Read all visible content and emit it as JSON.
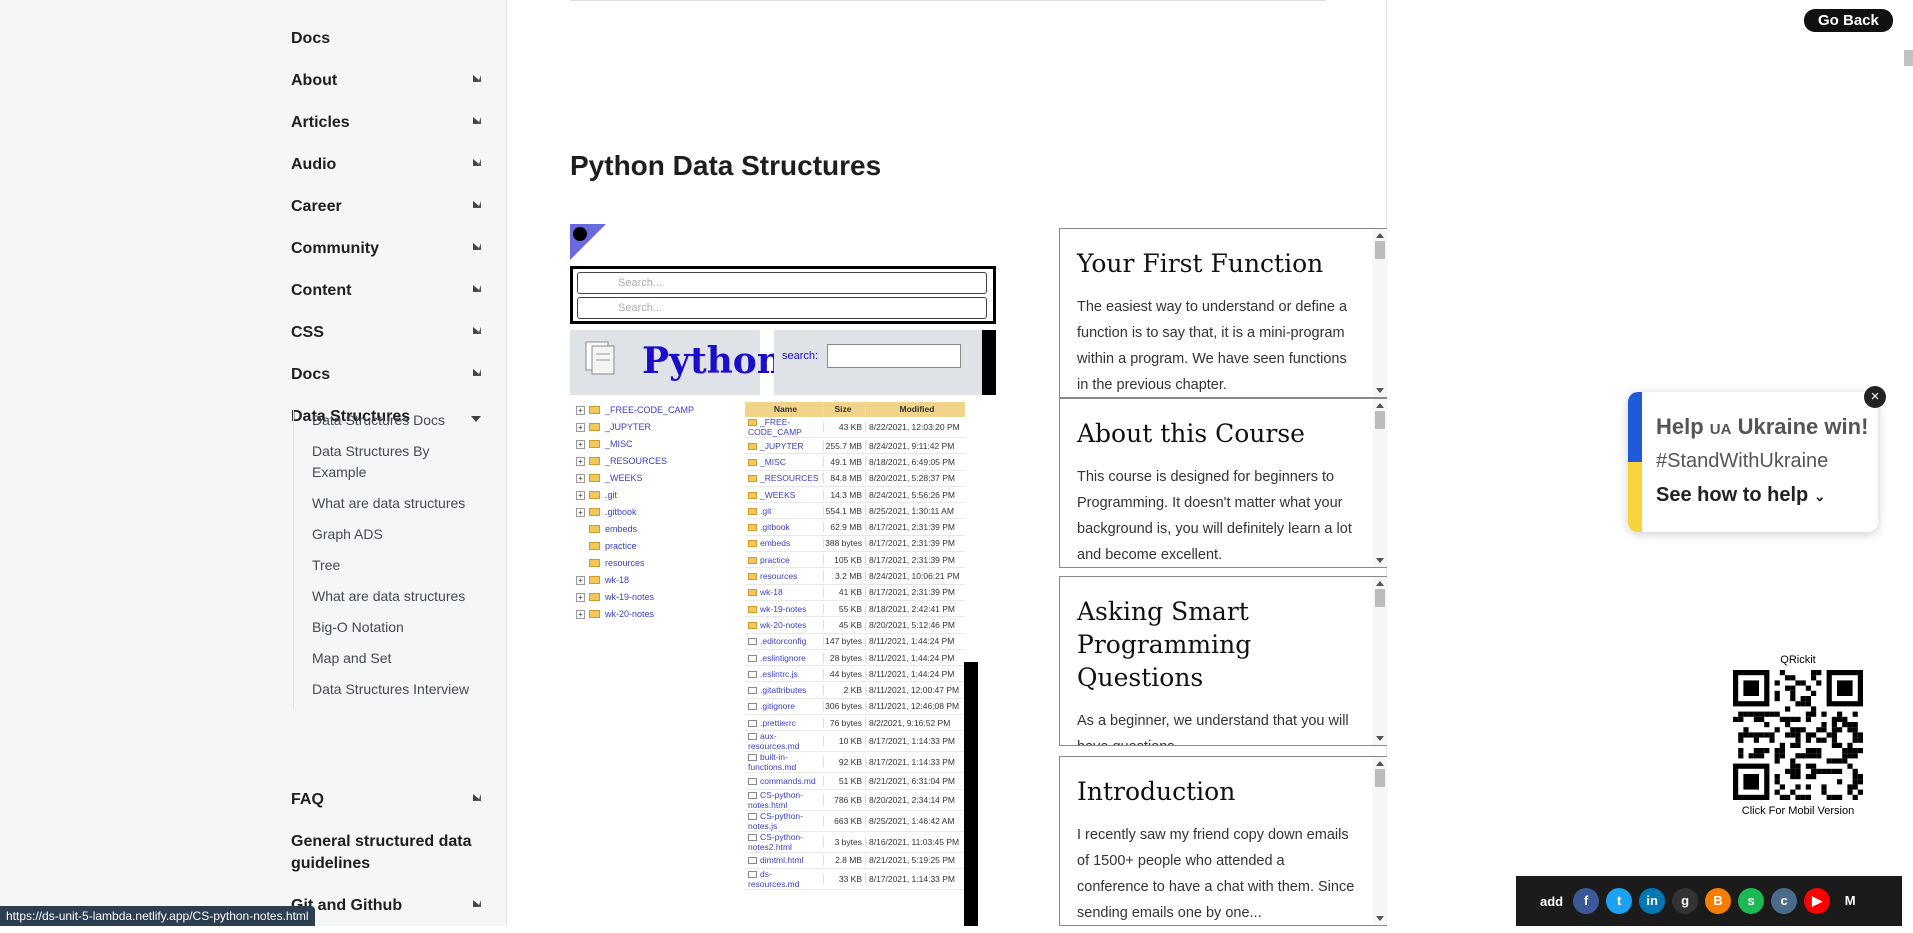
{
  "sidebar": {
    "items": [
      {
        "label": "Docs",
        "chevron": "none"
      },
      {
        "label": "About",
        "chevron": "right"
      },
      {
        "label": "Articles",
        "chevron": "right"
      },
      {
        "label": "Audio",
        "chevron": "right"
      },
      {
        "label": "Career",
        "chevron": "right"
      },
      {
        "label": "Community",
        "chevron": "right"
      },
      {
        "label": "Content",
        "chevron": "right"
      },
      {
        "label": "CSS",
        "chevron": "right"
      },
      {
        "label": "Docs",
        "chevron": "right"
      },
      {
        "label": "Data Structures",
        "chevron": "down"
      }
    ],
    "sub_items": [
      "Data Structures Docs",
      "Data Structures By Example",
      "What are data structures",
      "Graph ADS",
      "Tree",
      "What are data structures",
      "Big-O Notation",
      "Map and Set",
      "Data Structures Interview"
    ],
    "after_items": [
      {
        "label": "FAQ",
        "chevron": "right"
      },
      {
        "label": "General structured data guidelines",
        "chevron": "none"
      },
      {
        "label": "Git and Github",
        "chevron": "right"
      }
    ]
  },
  "status_url": "https://ds-unit-5-lambda.netlify.app/CS-python-notes.html",
  "page_title": "Python Data Structures",
  "browser": {
    "search_placeholder": "Search...",
    "header_title": "Python",
    "search_label": "search:",
    "tree": [
      "_FREE-CODE_CAMP",
      "_JUPYTER",
      "_MISC",
      "_RESOURCES",
      "_WEEKS",
      ".git",
      ".gitbook",
      "embeds",
      "practice",
      "resources",
      "wk-18",
      "wk-19-notes",
      "wk-20-notes"
    ],
    "columns": [
      "Name",
      "Size",
      "Modified"
    ],
    "rows": [
      [
        "_FREE-CODE_CAMP",
        "43 KB",
        "8/22/2021, 12:03:20 PM",
        "folder"
      ],
      [
        "_JUPYTER",
        "255.7 MB",
        "8/24/2021, 9:11:42 PM",
        "folder"
      ],
      [
        "_MISC",
        "49.1 MB",
        "8/18/2021, 6:49:05 PM",
        "folder"
      ],
      [
        "_RESOURCES",
        "84.8 MB",
        "8/20/2021, 5:28:37 PM",
        "folder"
      ],
      [
        "_WEEKS",
        "14.3 MB",
        "8/24/2021, 5:56:26 PM",
        "folder"
      ],
      [
        ".git",
        "554.1 MB",
        "8/25/2021, 1:30:11 AM",
        "folder"
      ],
      [
        ".gitbook",
        "62.9 MB",
        "8/17/2021, 2:31:39 PM",
        "folder"
      ],
      [
        "embeds",
        "388 bytes",
        "8/17/2021, 2:31:39 PM",
        "folder"
      ],
      [
        "practice",
        "105 KB",
        "8/17/2021, 2:31:39 PM",
        "folder"
      ],
      [
        "resources",
        "3.2 MB",
        "8/24/2021, 10:06:21 PM",
        "folder"
      ],
      [
        "wk-18",
        "41 KB",
        "8/17/2021, 2:31:39 PM",
        "folder"
      ],
      [
        "wk-19-notes",
        "55 KB",
        "8/18/2021, 2:42:41 PM",
        "folder"
      ],
      [
        "wk-20-notes",
        "45 KB",
        "8/20/2021, 5:12:46 PM",
        "folder"
      ],
      [
        ".editorconfig",
        "147 bytes",
        "8/11/2021, 1:44:24 PM",
        "file"
      ],
      [
        ".eslintignore",
        "28 bytes",
        "8/11/2021, 1:44:24 PM",
        "file"
      ],
      [
        ".eslintrc.js",
        "44 bytes",
        "8/11/2021, 1:44:24 PM",
        "file"
      ],
      [
        ".gitattributes",
        "2 KB",
        "8/11/2021, 12:00:47 PM",
        "file"
      ],
      [
        ".gitignore",
        "306 bytes",
        "8/11/2021, 12:46:08 PM",
        "file"
      ],
      [
        ".prettierrc",
        "76 bytes",
        "8/2/2021, 9:16:52 PM",
        "file"
      ],
      [
        "aux-resources.md",
        "10 KB",
        "8/17/2021, 1:14:33 PM",
        "file"
      ],
      [
        "built-in-functions.md",
        "92 KB",
        "8/17/2021, 1:14:33 PM",
        "file"
      ],
      [
        "commands.md",
        "51 KB",
        "8/21/2021, 6:31:04 PM",
        "file"
      ],
      [
        "CS-python-notes.html",
        "786 KB",
        "8/20/2021, 2:34:14 PM",
        "file"
      ],
      [
        "CS-python-notes.js",
        "663 KB",
        "8/25/2021, 1:46:42 AM",
        "file"
      ],
      [
        "CS-python-notes2.html",
        "3 bytes",
        "8/16/2021, 11:03:45 PM",
        "file"
      ],
      [
        "dimtml.html",
        "2.8 MB",
        "8/21/2021, 5:19:25 PM",
        "file"
      ],
      [
        "ds-resources.md",
        "33 KB",
        "8/17/2021, 1:14:33 PM",
        "file"
      ]
    ]
  },
  "cards": [
    {
      "title": "Your First Function",
      "body": "The easiest way to understand or define a function is to say that, it is a mini-program within a program. We have seen functions in the previous chapter."
    },
    {
      "title": "About this Course",
      "body": "This course is designed for beginners to Programming. It doesn't matter what your background is, you will definitely learn a lot and become excellent."
    },
    {
      "title": "Asking Smart Programming Questions",
      "body": "As a beginner, we understand that you will have questions."
    },
    {
      "title": "Introduction",
      "body": "I recently saw my friend copy down emails of 1500+ people who attended a conference to have a chat with them. Since sending emails one by one..."
    }
  ],
  "go_back": "Go Back",
  "ukraine": {
    "title_a": "Help ",
    "title_ua": "UA",
    "title_b": " Ukraine win!",
    "tag": "#StandWithUkraine",
    "link": "See how to help",
    "close": "×"
  },
  "qr": {
    "title": "QRickit",
    "caption": "Click For Mobil Version"
  },
  "share": {
    "add_label": "add",
    "icons": [
      {
        "name": "facebook-icon",
        "color": "#3b5998",
        "glyph": "f"
      },
      {
        "name": "twitter-icon",
        "color": "#1da1f2",
        "glyph": "t"
      },
      {
        "name": "linkedin-icon",
        "color": "#0077b5",
        "glyph": "in"
      },
      {
        "name": "github-icon",
        "color": "#333333",
        "glyph": "g"
      },
      {
        "name": "blogger-icon",
        "color": "#f57d00",
        "glyph": "B"
      },
      {
        "name": "spotify-icon",
        "color": "#1db954",
        "glyph": "s"
      },
      {
        "name": "cloud-icon",
        "color": "#4a6b8a",
        "glyph": "c"
      },
      {
        "name": "youtube-icon",
        "color": "#ff0000",
        "glyph": "▶"
      },
      {
        "name": "medium-icon",
        "color": "#1b1b1b",
        "glyph": "M"
      }
    ]
  }
}
